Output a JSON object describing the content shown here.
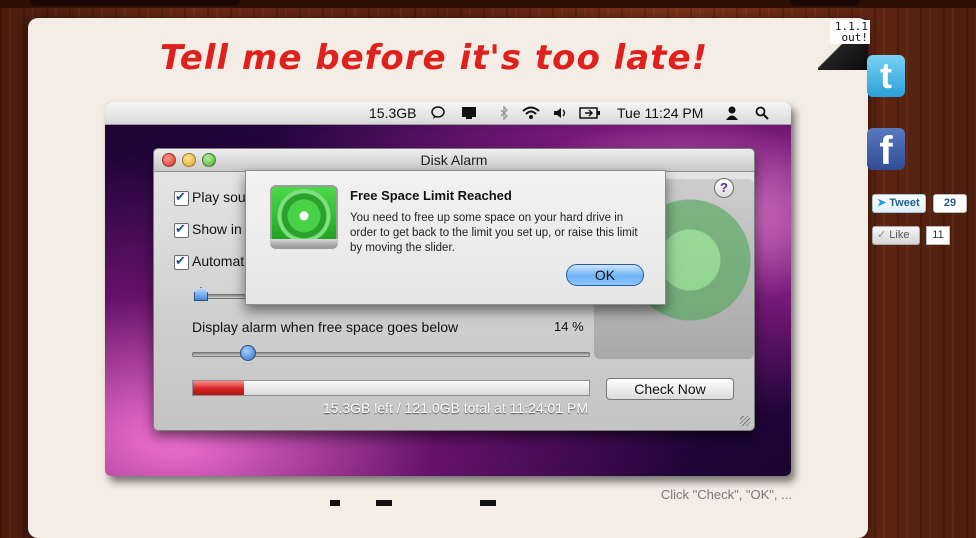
{
  "page": {
    "headline": "Tell me before it's too late!",
    "version_badge": "1.1.1 out!",
    "caption": "Click \"Check\", \"OK\", ..."
  },
  "social": {
    "twitter_icon": "twitter-icon",
    "facebook_icon": "facebook-icon",
    "tweet_label": "Tweet",
    "tweet_count": "29",
    "like_label": "Like",
    "like_count": "11"
  },
  "menubar": {
    "disk_free": "15.3GB",
    "clock": "Tue 11:24 PM",
    "icons": [
      "speech-bubble-icon",
      "display-icon",
      "bluetooth-icon",
      "wifi-icon",
      "volume-icon",
      "battery-icon",
      "user-icon",
      "spotlight-icon"
    ]
  },
  "window": {
    "title": "Disk Alarm",
    "options": [
      {
        "label": "Play sou",
        "checked": true
      },
      {
        "label": "Show in",
        "checked": true
      },
      {
        "label": "Automat",
        "checked": true
      }
    ],
    "alarm_label": "Display alarm when free space goes below",
    "alarm_percent": "14 %",
    "alarm_slider_value": 14,
    "usage_fraction": 0.13,
    "check_button": "Check Now",
    "status": "15.3GB left / 121.0GB total at 11:24:01 PM"
  },
  "sheet": {
    "title": "Free Space Limit Reached",
    "body": "You need to free up some space on your hard drive in order to get back to the limit you set up, or raise this limit by moving the slider.",
    "ok_button": "OK",
    "help": "?"
  }
}
